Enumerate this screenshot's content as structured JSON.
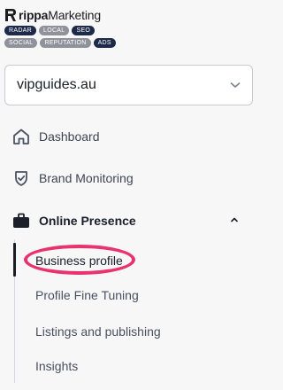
{
  "brand": {
    "name_bold": "rippa",
    "name_rest": "Marketing"
  },
  "badges": {
    "row1": [
      "RADAR",
      "LOCAL",
      "SEO"
    ],
    "row2": [
      "SOCIAL",
      "REPUTATION",
      "ADS"
    ]
  },
  "site_selector": {
    "value": "vipguides.au"
  },
  "nav": {
    "dashboard": "Dashboard",
    "brand_monitoring": "Brand Monitoring",
    "online_presence": "Online Presence"
  },
  "submenu": {
    "business_profile": "Business profile",
    "profile_fine_tuning": "Profile Fine Tuning",
    "listings_publishing": "Listings and publishing",
    "insights": "Insights"
  },
  "colors": {
    "highlight": "#e8336d",
    "badge_dark": "#1e2a4a",
    "badge_grey": "#8f929b"
  },
  "icons": [
    "home-icon",
    "shield-check-icon",
    "briefcase-icon",
    "chevron-up-icon",
    "chevron-down-icon"
  ]
}
